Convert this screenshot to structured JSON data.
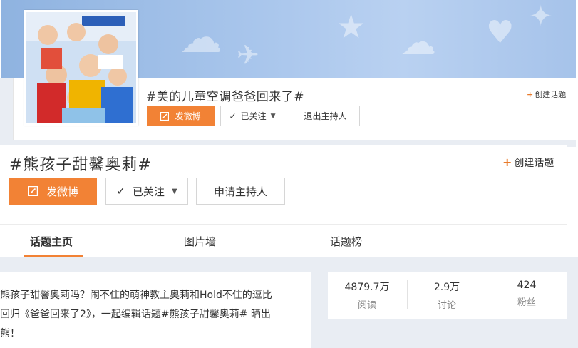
{
  "top_card": {
    "title": "#美的儿童空调爸爸回来了#",
    "create_label": "创建话题",
    "post_label": "发微博",
    "follow_label": "已关注",
    "host_label": "退出主持人"
  },
  "main_card": {
    "title": "#熊孩子甜馨奥莉#",
    "create_label": "创建话题",
    "post_label": "发微博",
    "follow_label": "已关注",
    "host_label": "申请主持人"
  },
  "tabs": [
    {
      "label": "话题主页",
      "active": true
    },
    {
      "label": "图片墙",
      "active": false
    },
    {
      "label": "话题榜",
      "active": false
    }
  ],
  "description": "熊孩子甜馨奥莉吗？闹不住的萌神教主奥莉和Hold不住的逗比\n回归《爸爸回来了2》，一起编辑话题#熊孩子甜馨奥莉# 晒出\n熊！",
  "stats": [
    {
      "value": "4879.7万",
      "label": "阅读"
    },
    {
      "value": "2.9万",
      "label": "讨论"
    },
    {
      "value": "424",
      "label": "粉丝"
    }
  ],
  "colors": {
    "accent": "#f28235",
    "banner": "#a9c6ec",
    "page_bg": "#e9edf3"
  }
}
